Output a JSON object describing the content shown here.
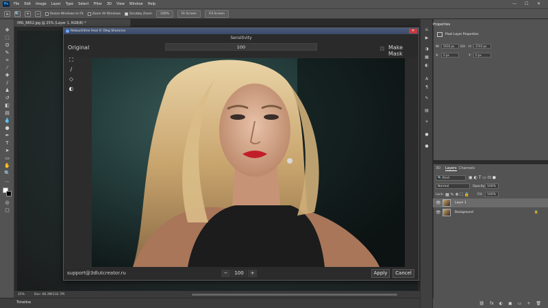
{
  "menu": [
    "File",
    "Edit",
    "Image",
    "Layer",
    "Type",
    "Select",
    "Filter",
    "3D",
    "View",
    "Window",
    "Help"
  ],
  "app_logo": "Ps",
  "window_controls": [
    "—",
    "☐",
    "✕"
  ],
  "options": {
    "resize_windows": "Resize Windows to Fit",
    "zoom_all": "Zoom All Windows",
    "scrubby_zoom": "Scrubby Zoom",
    "zoom_level": "100%",
    "fit_screen": "Fit Screen",
    "fill_screen": "Fill Screen"
  },
  "document": {
    "tab_title": "IMG_8852.jpg @ 25% (Layer 1, RGB/8) *",
    "zoom": "25%",
    "doc_size": "Doc: 66.3M/132.7M"
  },
  "timeline_label": "Timeline",
  "plugin": {
    "title": "Retouch4me Heal © Oleg Sharonov",
    "sensitivity_label": "Sensitivity",
    "sensitivity_value": "100",
    "original_label": "Original",
    "make_mask_label": "Make Mask",
    "support_email": "support@3dlutcreator.ru",
    "stepper_minus": "−",
    "stepper_value": "100",
    "stepper_plus": "+",
    "apply_label": "Apply",
    "cancel_label": "Cancel"
  },
  "properties": {
    "tab": "Properties",
    "subtitle": "Pixel Layer Properties",
    "w_label": "W:",
    "w_value": "5616 px",
    "h_label": "H:",
    "h_value": "3744 px",
    "x_label": "X:",
    "x_value": "0 px",
    "y_label": "Y:",
    "y_value": "0 px",
    "link_glyph": "GO"
  },
  "layers": {
    "tabs": [
      "3D",
      "Layers",
      "Channels"
    ],
    "kind_filter": "Kind",
    "blend_mode": "Normal",
    "opacity_label": "Opacity:",
    "opacity_value": "100%",
    "lock_label": "Lock:",
    "fill_label": "Fill:",
    "fill_value": "100%",
    "items": [
      {
        "name": "Layer 1",
        "selected": true
      },
      {
        "name": "Background",
        "selected": false,
        "locked": true
      }
    ],
    "footer_icons": [
      "⛓",
      "fx",
      "◐",
      "▣",
      "▭",
      "+",
      "🗑"
    ]
  },
  "colors": {
    "panel_bg": "#535353",
    "dialog_bg": "#2c2c2c",
    "title_bar": "#3b4966"
  }
}
